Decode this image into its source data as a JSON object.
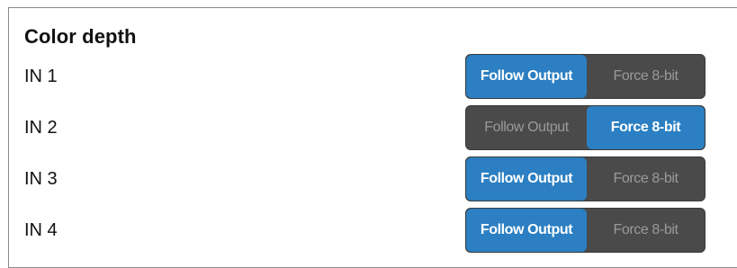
{
  "section": {
    "title": "Color depth"
  },
  "options": {
    "follow_label": "Follow Output",
    "force_label": "Force 8-bit"
  },
  "inputs": [
    {
      "label": "IN 1",
      "selected": "Follow Output"
    },
    {
      "label": "IN 2",
      "selected": "Force 8-bit"
    },
    {
      "label": "IN 3",
      "selected": "Follow Output"
    },
    {
      "label": "IN 4",
      "selected": "Follow Output"
    }
  ],
  "colors": {
    "active": "#2b7fc2",
    "inactive_bg": "#4a4a4a",
    "inactive_text": "#9a9a9a"
  }
}
